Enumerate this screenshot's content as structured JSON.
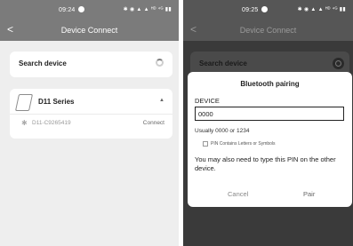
{
  "left": {
    "status": {
      "time": "09:24",
      "icons": "✱ ◉ ▲ ▲ ᴴᴰ ⁴ᴳ ▮▮"
    },
    "header": {
      "back": "<",
      "title": "Device Connect"
    },
    "search": {
      "label": "Search device"
    },
    "series": {
      "name": "D11 Series",
      "caret": "▲",
      "device": {
        "bt_icon": "✱",
        "name": "D11-C9265419",
        "action": "Connect"
      }
    }
  },
  "right": {
    "status": {
      "time": "09:25",
      "icons": "✱ ◉ ▲ ▲ ᴴᴰ ⁴ᴳ ▮▮"
    },
    "header": {
      "back": "<",
      "title": "Device Connect"
    },
    "search": {
      "label": "Search device"
    },
    "dialog": {
      "title": "Bluetooth pairing",
      "device_label": "DEVICE",
      "pin_value": "0000",
      "hint": "Usually 0000 or 1234",
      "checkbox_label": "PIN Contains Letters or Symbols",
      "note": "You may also need to type this PIN on the other device.",
      "cancel": "Cancel",
      "pair": "Pair"
    }
  }
}
